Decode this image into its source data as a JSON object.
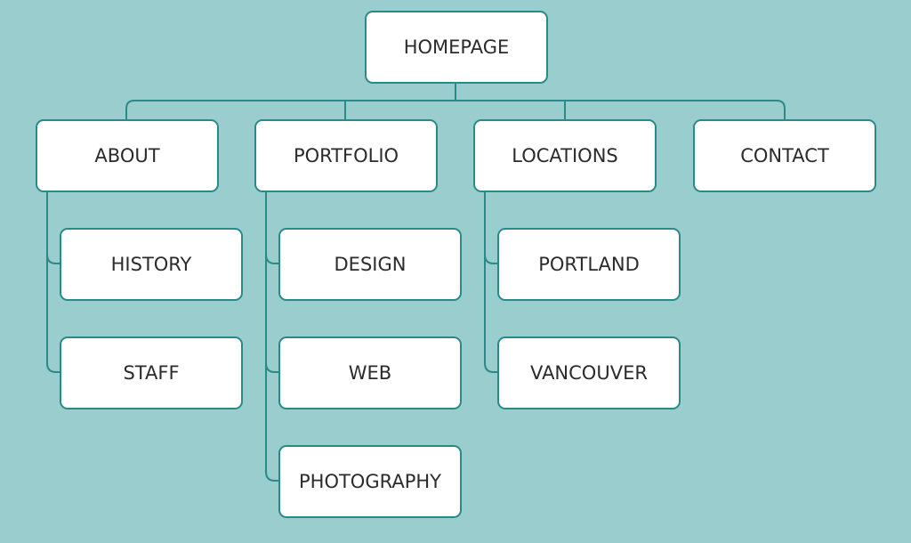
{
  "diagram": {
    "type": "sitemap",
    "colors": {
      "background": "#9acdcd",
      "stroke": "#2a8a88",
      "box": "#ffffff",
      "text": "#2b2b2b"
    },
    "root": {
      "label": "HOMEPAGE"
    },
    "sections": [
      {
        "label": "ABOUT",
        "children": [
          {
            "label": "HISTORY"
          },
          {
            "label": "STAFF"
          }
        ]
      },
      {
        "label": "PORTFOLIO",
        "children": [
          {
            "label": "DESIGN"
          },
          {
            "label": "WEB"
          },
          {
            "label": "PHOTOGRAPHY"
          }
        ]
      },
      {
        "label": "LOCATIONS",
        "children": [
          {
            "label": "PORTLAND"
          },
          {
            "label": "VANCOUVER"
          }
        ]
      },
      {
        "label": "CONTACT",
        "children": []
      }
    ]
  }
}
